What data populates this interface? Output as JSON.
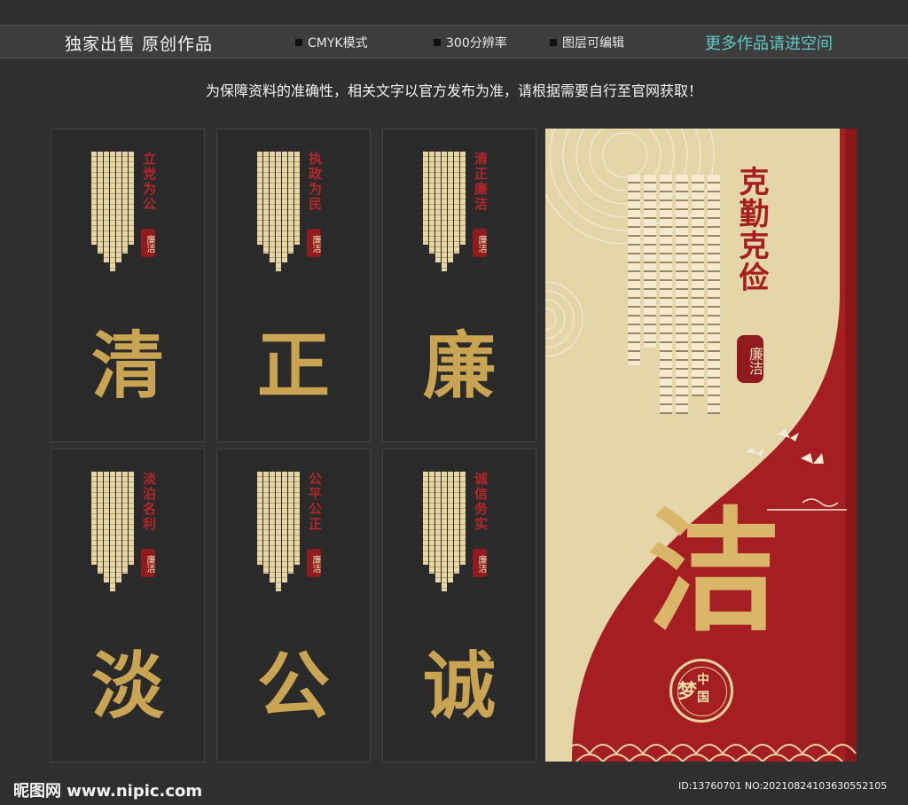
{
  "topbar": {
    "brand": "独家出售  原创作品",
    "features": [
      "CMYK模式",
      "300分辨率",
      "图层可编辑"
    ],
    "more": "更多作品请进空间"
  },
  "notice": "为保障资料的准确性，相关文字以官方发布为准，请根据需要自行至官网获取！",
  "panels": [
    {
      "vertical": "立党为公",
      "seal": "廉洁",
      "big": "清"
    },
    {
      "vertical": "执政为民",
      "seal": "廉洁",
      "big": "正"
    },
    {
      "vertical": "清正廉洁",
      "seal": "廉洁",
      "big": "廉"
    },
    {
      "vertical": "淡泊名利",
      "seal": "廉洁",
      "big": "淡"
    },
    {
      "vertical": "公平公正",
      "seal": "廉洁",
      "big": "公"
    },
    {
      "vertical": "诚信务实",
      "seal": "廉洁",
      "big": "诚"
    }
  ],
  "poster": {
    "title": "克勤克俭",
    "seal": "廉洁",
    "big": "洁",
    "stamp": {
      "script": "梦",
      "top": "中",
      "bottom": "国"
    },
    "colors": {
      "red": "#a51f22",
      "cream": "#e4d6a9",
      "gold": "#d9b66a"
    }
  },
  "footer": {
    "logo": "昵图网 www.nipic.com",
    "id": "ID:13760701 NO:20210824103630552105"
  },
  "colors": {
    "background": "#2f2f2f",
    "accent_teal": "#5fc9c4",
    "panel_gold": "#c9a553",
    "panel_red": "#b3262a"
  }
}
